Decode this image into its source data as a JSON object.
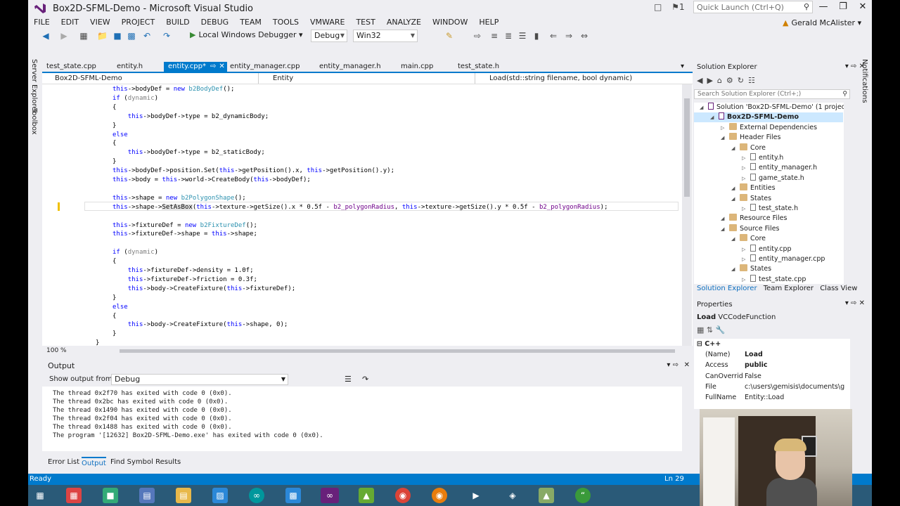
{
  "window": {
    "title": "Box2D-SFML-Demo - Microsoft Visual Studio",
    "flag_count": "1",
    "quick_launch": "Quick Launch (Ctrl+Q)",
    "user": "Gerald McAlister"
  },
  "menu": [
    "FILE",
    "EDIT",
    "VIEW",
    "PROJECT",
    "BUILD",
    "DEBUG",
    "TEAM",
    "TOOLS",
    "VMWARE",
    "TEST",
    "ANALYZE",
    "WINDOW",
    "HELP"
  ],
  "toolbar": {
    "debugger": "Local Windows Debugger",
    "config": "Debug",
    "platform": "Win32"
  },
  "side_tabs": [
    "Server Explorer",
    "Toolbox"
  ],
  "tabs": [
    "test_state.cpp",
    "entity.h",
    "entity.cpp*",
    "entity_manager.cpp",
    "entity_manager.h",
    "main.cpp",
    "test_state.h"
  ],
  "active_tab": "entity.cpp*",
  "nav": {
    "project": "Box2D-SFML-Demo",
    "scope": "Entity",
    "member": "Load(std::string filename, bool dynamic)"
  },
  "code": [
    "this->bodyDef = new b2BodyDef();",
    "if (dynamic)",
    "{",
    "    this->bodyDef->type = b2_dynamicBody;",
    "}",
    "else",
    "{",
    "    this->bodyDef->type = b2_staticBody;",
    "}",
    "this->bodyDef->position.Set(this->getPosition().x, this->getPosition().y);",
    "this->body = this->world->CreateBody(this->bodyDef);",
    "",
    "this->shape = new b2PolygonShape();",
    "this->shape->SetAsBox(this->texture->getSize().x * 0.5f - b2_polygonRadius, this->texture->getSize().y * 0.5f - b2_polygonRadius);",
    "",
    "this->fixtureDef = new b2FixtureDef();",
    "this->fixtureDef->shape = this->shape;",
    "",
    "if (dynamic)",
    "{",
    "    this->fixtureDef->density = 1.0f;",
    "    this->fixtureDef->friction = 0.3f;",
    "    this->body->CreateFixture(this->fixtureDef);",
    "}",
    "else",
    "{",
    "    this->body->CreateFixture(this->shape, 0);",
    "}",
    "}"
  ],
  "zoom": "100 %",
  "output": {
    "title": "Output",
    "show_from_label": "Show output from:",
    "source": "Debug",
    "lines": [
      "The thread 0x2f70 has exited with code 0 (0x0).",
      "The thread 0x2bc has exited with code 0 (0x0).",
      "The thread 0x1490 has exited with code 0 (0x0).",
      "The thread 0x2f04 has exited with code 0 (0x0).",
      "The thread 0x1488 has exited with code 0 (0x0).",
      "The program '[12632] Box2D-SFML-Demo.exe' has exited with code 0 (0x0)."
    ]
  },
  "bottom_tabs": [
    "Error List",
    "Output",
    "Find Symbol Results"
  ],
  "status": {
    "left": "Ready",
    "line": "Ln 29"
  },
  "solution_explorer": {
    "title": "Solution Explorer",
    "search": "Search Solution Explorer (Ctrl+;)",
    "tree": [
      {
        "label": "Solution 'Box2D-SFML-Demo' (1 project)",
        "level": 0,
        "kind": "solution"
      },
      {
        "label": "Box2D-SFML-Demo",
        "level": 1,
        "kind": "project",
        "selected": true
      },
      {
        "label": "External Dependencies",
        "level": 2,
        "kind": "folder"
      },
      {
        "label": "Header Files",
        "level": 2,
        "kind": "folder"
      },
      {
        "label": "Core",
        "level": 3,
        "kind": "folder"
      },
      {
        "label": "entity.h",
        "level": 4,
        "kind": "file"
      },
      {
        "label": "entity_manager.h",
        "level": 4,
        "kind": "file"
      },
      {
        "label": "game_state.h",
        "level": 4,
        "kind": "file"
      },
      {
        "label": "Entities",
        "level": 3,
        "kind": "folder"
      },
      {
        "label": "States",
        "level": 3,
        "kind": "folder"
      },
      {
        "label": "test_state.h",
        "level": 4,
        "kind": "file"
      },
      {
        "label": "Resource Files",
        "level": 2,
        "kind": "folder"
      },
      {
        "label": "Source Files",
        "level": 2,
        "kind": "folder"
      },
      {
        "label": "Core",
        "level": 3,
        "kind": "folder"
      },
      {
        "label": "entity.cpp",
        "level": 4,
        "kind": "file"
      },
      {
        "label": "entity_manager.cpp",
        "level": 4,
        "kind": "file"
      },
      {
        "label": "States",
        "level": 3,
        "kind": "folder"
      },
      {
        "label": "test_state.cpp",
        "level": 4,
        "kind": "file"
      }
    ],
    "tabs": [
      "Solution Explorer",
      "Team Explorer",
      "Class View"
    ]
  },
  "properties": {
    "title": "Properties",
    "object": "Load",
    "object_type": "VCCodeFunction",
    "category": "C++",
    "rows": [
      {
        "name": "(Name)",
        "value": "Load"
      },
      {
        "name": "Access",
        "value": "public"
      },
      {
        "name": "CanOverrid",
        "value": "False"
      },
      {
        "name": "File",
        "value": "c:\\users\\gemisis\\documents\\g"
      },
      {
        "name": "FullName",
        "value": "Entity::Load"
      }
    ]
  },
  "notifications": "Notifications",
  "colors": {
    "accent": "#007acc",
    "keyword": "#0000ff",
    "type": "#2b91af",
    "param": "#808080"
  }
}
